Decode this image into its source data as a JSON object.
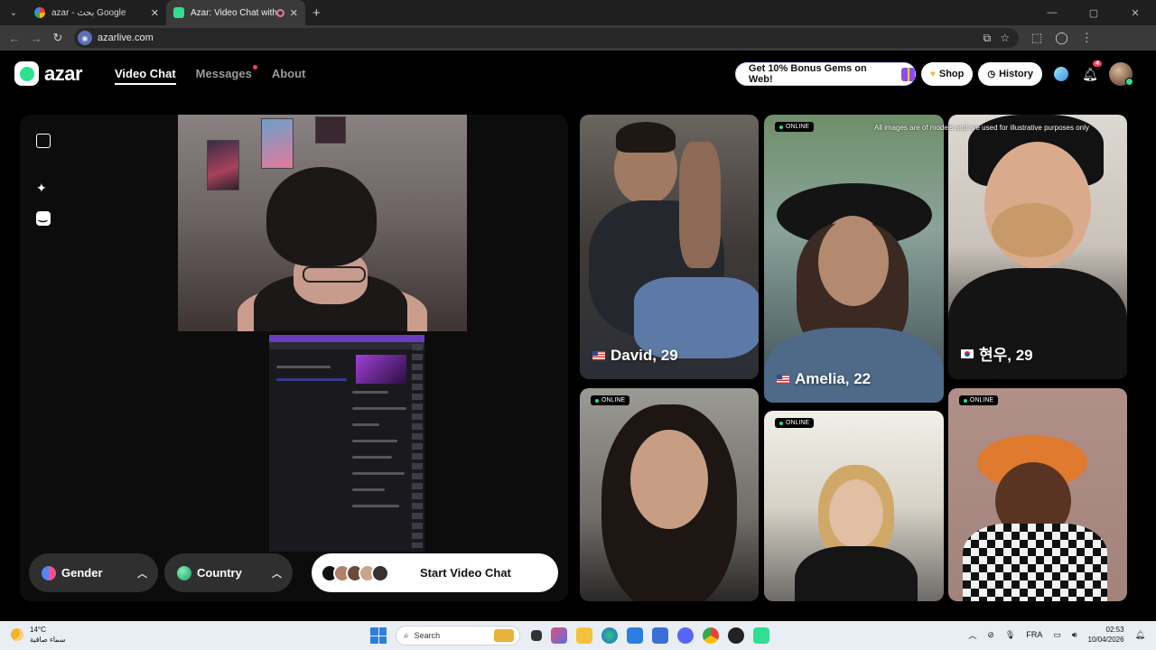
{
  "browser": {
    "tabs": [
      {
        "title": "azar - بحث Google",
        "active": false
      },
      {
        "title": "Azar: Video Chat with New",
        "active": true
      }
    ],
    "url": "azarlive.com",
    "window_controls": [
      "—",
      "▢",
      "✕"
    ]
  },
  "site": {
    "logo": "azar",
    "nav": [
      {
        "label": "Video Chat",
        "active": true
      },
      {
        "label": "Messages",
        "active": false,
        "has_dot": true
      },
      {
        "label": "About",
        "active": false
      }
    ],
    "promo": "Get 10% Bonus Gems on Web!",
    "shop": "Shop",
    "history": "History",
    "notification_count": "4"
  },
  "stage": {
    "gender_label": "Gender",
    "country_label": "Country",
    "start_label": "Start Video Chat"
  },
  "grid": {
    "disclaimer": "All images are of models and are used for illustrative purposes only",
    "online_label": "ONLINE",
    "cards": [
      {
        "name": "David, 29",
        "flag": "us"
      },
      {
        "name": "Amelia, 22",
        "flag": "us"
      },
      {
        "name": "현우, 29",
        "flag": "kr"
      }
    ]
  },
  "taskbar": {
    "temperature": "14°C",
    "weather": "سماء صافية",
    "search_placeholder": "Search",
    "language": "FRA",
    "time": "02:53",
    "date": "10/04/2026"
  },
  "colors": {
    "accent_green": "#2ee08f",
    "notification_red": "#ff3b5c"
  }
}
